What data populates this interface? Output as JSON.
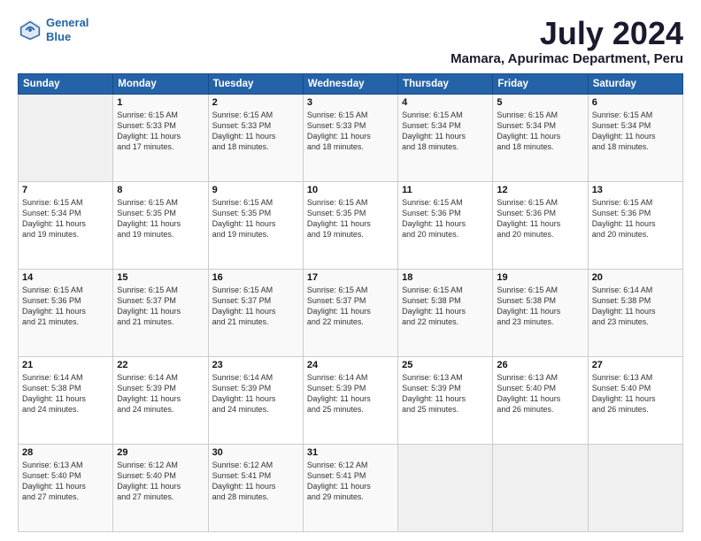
{
  "header": {
    "logo_line1": "General",
    "logo_line2": "Blue",
    "month": "July 2024",
    "location": "Mamara, Apurimac Department, Peru"
  },
  "weekdays": [
    "Sunday",
    "Monday",
    "Tuesday",
    "Wednesday",
    "Thursday",
    "Friday",
    "Saturday"
  ],
  "weeks": [
    [
      {
        "day": "",
        "info": ""
      },
      {
        "day": "1",
        "info": "Sunrise: 6:15 AM\nSunset: 5:33 PM\nDaylight: 11 hours\nand 17 minutes."
      },
      {
        "day": "2",
        "info": "Sunrise: 6:15 AM\nSunset: 5:33 PM\nDaylight: 11 hours\nand 18 minutes."
      },
      {
        "day": "3",
        "info": "Sunrise: 6:15 AM\nSunset: 5:33 PM\nDaylight: 11 hours\nand 18 minutes."
      },
      {
        "day": "4",
        "info": "Sunrise: 6:15 AM\nSunset: 5:34 PM\nDaylight: 11 hours\nand 18 minutes."
      },
      {
        "day": "5",
        "info": "Sunrise: 6:15 AM\nSunset: 5:34 PM\nDaylight: 11 hours\nand 18 minutes."
      },
      {
        "day": "6",
        "info": "Sunrise: 6:15 AM\nSunset: 5:34 PM\nDaylight: 11 hours\nand 18 minutes."
      }
    ],
    [
      {
        "day": "7",
        "info": "Sunrise: 6:15 AM\nSunset: 5:34 PM\nDaylight: 11 hours\nand 19 minutes."
      },
      {
        "day": "8",
        "info": "Sunrise: 6:15 AM\nSunset: 5:35 PM\nDaylight: 11 hours\nand 19 minutes."
      },
      {
        "day": "9",
        "info": "Sunrise: 6:15 AM\nSunset: 5:35 PM\nDaylight: 11 hours\nand 19 minutes."
      },
      {
        "day": "10",
        "info": "Sunrise: 6:15 AM\nSunset: 5:35 PM\nDaylight: 11 hours\nand 19 minutes."
      },
      {
        "day": "11",
        "info": "Sunrise: 6:15 AM\nSunset: 5:36 PM\nDaylight: 11 hours\nand 20 minutes."
      },
      {
        "day": "12",
        "info": "Sunrise: 6:15 AM\nSunset: 5:36 PM\nDaylight: 11 hours\nand 20 minutes."
      },
      {
        "day": "13",
        "info": "Sunrise: 6:15 AM\nSunset: 5:36 PM\nDaylight: 11 hours\nand 20 minutes."
      }
    ],
    [
      {
        "day": "14",
        "info": "Sunrise: 6:15 AM\nSunset: 5:36 PM\nDaylight: 11 hours\nand 21 minutes."
      },
      {
        "day": "15",
        "info": "Sunrise: 6:15 AM\nSunset: 5:37 PM\nDaylight: 11 hours\nand 21 minutes."
      },
      {
        "day": "16",
        "info": "Sunrise: 6:15 AM\nSunset: 5:37 PM\nDaylight: 11 hours\nand 21 minutes."
      },
      {
        "day": "17",
        "info": "Sunrise: 6:15 AM\nSunset: 5:37 PM\nDaylight: 11 hours\nand 22 minutes."
      },
      {
        "day": "18",
        "info": "Sunrise: 6:15 AM\nSunset: 5:38 PM\nDaylight: 11 hours\nand 22 minutes."
      },
      {
        "day": "19",
        "info": "Sunrise: 6:15 AM\nSunset: 5:38 PM\nDaylight: 11 hours\nand 23 minutes."
      },
      {
        "day": "20",
        "info": "Sunrise: 6:14 AM\nSunset: 5:38 PM\nDaylight: 11 hours\nand 23 minutes."
      }
    ],
    [
      {
        "day": "21",
        "info": "Sunrise: 6:14 AM\nSunset: 5:38 PM\nDaylight: 11 hours\nand 24 minutes."
      },
      {
        "day": "22",
        "info": "Sunrise: 6:14 AM\nSunset: 5:39 PM\nDaylight: 11 hours\nand 24 minutes."
      },
      {
        "day": "23",
        "info": "Sunrise: 6:14 AM\nSunset: 5:39 PM\nDaylight: 11 hours\nand 24 minutes."
      },
      {
        "day": "24",
        "info": "Sunrise: 6:14 AM\nSunset: 5:39 PM\nDaylight: 11 hours\nand 25 minutes."
      },
      {
        "day": "25",
        "info": "Sunrise: 6:13 AM\nSunset: 5:39 PM\nDaylight: 11 hours\nand 25 minutes."
      },
      {
        "day": "26",
        "info": "Sunrise: 6:13 AM\nSunset: 5:40 PM\nDaylight: 11 hours\nand 26 minutes."
      },
      {
        "day": "27",
        "info": "Sunrise: 6:13 AM\nSunset: 5:40 PM\nDaylight: 11 hours\nand 26 minutes."
      }
    ],
    [
      {
        "day": "28",
        "info": "Sunrise: 6:13 AM\nSunset: 5:40 PM\nDaylight: 11 hours\nand 27 minutes."
      },
      {
        "day": "29",
        "info": "Sunrise: 6:12 AM\nSunset: 5:40 PM\nDaylight: 11 hours\nand 27 minutes."
      },
      {
        "day": "30",
        "info": "Sunrise: 6:12 AM\nSunset: 5:41 PM\nDaylight: 11 hours\nand 28 minutes."
      },
      {
        "day": "31",
        "info": "Sunrise: 6:12 AM\nSunset: 5:41 PM\nDaylight: 11 hours\nand 29 minutes."
      },
      {
        "day": "",
        "info": ""
      },
      {
        "day": "",
        "info": ""
      },
      {
        "day": "",
        "info": ""
      }
    ]
  ]
}
